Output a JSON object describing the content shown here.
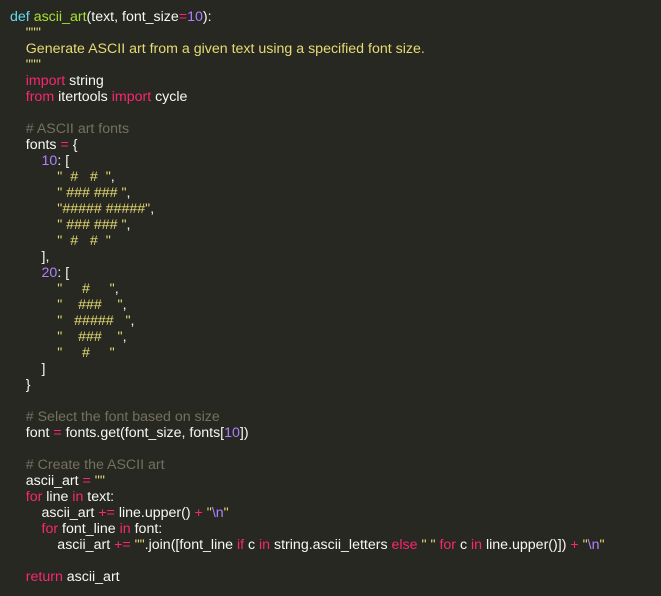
{
  "colors": {
    "background": "#272822",
    "plain": "#f8f8f2",
    "keyword": "#f92672",
    "def_keyword": "#66d9ef",
    "function_name": "#a6e22e",
    "string": "#e6db74",
    "number": "#ae81ff",
    "comment": "#75715e"
  },
  "code": {
    "lines": [
      [
        [
          "kwd",
          "def"
        ],
        [
          "pln",
          " "
        ],
        [
          "fn",
          "ascii_art"
        ],
        [
          "pln",
          "(text, font_size"
        ],
        [
          "op",
          "="
        ],
        [
          "num",
          "10"
        ],
        [
          "pln",
          "):"
        ]
      ],
      [
        [
          "str",
          "    \"\"\""
        ]
      ],
      [
        [
          "str",
          "    Generate ASCII art from a given text using a specified font size."
        ]
      ],
      [
        [
          "str",
          "    \"\"\""
        ]
      ],
      [
        [
          "kw",
          "    import"
        ],
        [
          "pln",
          " string"
        ]
      ],
      [
        [
          "kw",
          "    from"
        ],
        [
          "pln",
          " itertools "
        ],
        [
          "kw",
          "import"
        ],
        [
          "pln",
          " cycle"
        ]
      ],
      [
        [
          "pln",
          ""
        ]
      ],
      [
        [
          "com",
          "    # ASCII art fonts"
        ]
      ],
      [
        [
          "pln",
          "    fonts "
        ],
        [
          "op",
          "="
        ],
        [
          "pln",
          " {"
        ]
      ],
      [
        [
          "num",
          "        10"
        ],
        [
          "pln",
          ": ["
        ]
      ],
      [
        [
          "str",
          "            \"  #   #  \""
        ],
        [
          "pln",
          ","
        ]
      ],
      [
        [
          "str",
          "            \" ### ### \""
        ],
        [
          "pln",
          ","
        ]
      ],
      [
        [
          "str",
          "            \"##### #####\""
        ],
        [
          "pln",
          ","
        ]
      ],
      [
        [
          "str",
          "            \" ### ### \""
        ],
        [
          "pln",
          ","
        ]
      ],
      [
        [
          "str",
          "            \"  #   #  \""
        ]
      ],
      [
        [
          "pln",
          "        ],"
        ]
      ],
      [
        [
          "num",
          "        20"
        ],
        [
          "pln",
          ": ["
        ]
      ],
      [
        [
          "str",
          "            \"     #     \""
        ],
        [
          "pln",
          ","
        ]
      ],
      [
        [
          "str",
          "            \"    ###    \""
        ],
        [
          "pln",
          ","
        ]
      ],
      [
        [
          "str",
          "            \"   #####   \""
        ],
        [
          "pln",
          ","
        ]
      ],
      [
        [
          "str",
          "            \"    ###    \""
        ],
        [
          "pln",
          ","
        ]
      ],
      [
        [
          "str",
          "            \"     #     \""
        ]
      ],
      [
        [
          "pln",
          "        ]"
        ]
      ],
      [
        [
          "pln",
          "    }"
        ]
      ],
      [
        [
          "pln",
          ""
        ]
      ],
      [
        [
          "com",
          "    # Select the font based on size"
        ]
      ],
      [
        [
          "pln",
          "    font "
        ],
        [
          "op",
          "="
        ],
        [
          "pln",
          " fonts.get(font_size, fonts["
        ],
        [
          "num",
          "10"
        ],
        [
          "pln",
          "])"
        ]
      ],
      [
        [
          "pln",
          ""
        ]
      ],
      [
        [
          "com",
          "    # Create the ASCII art"
        ]
      ],
      [
        [
          "pln",
          "    ascii_art "
        ],
        [
          "op",
          "="
        ],
        [
          "str",
          " \"\""
        ]
      ],
      [
        [
          "kw",
          "    for"
        ],
        [
          "pln",
          " line "
        ],
        [
          "kw",
          "in"
        ],
        [
          "pln",
          " text:"
        ]
      ],
      [
        [
          "pln",
          "        ascii_art "
        ],
        [
          "op",
          "+="
        ],
        [
          "pln",
          " line.upper() "
        ],
        [
          "op",
          "+"
        ],
        [
          "str",
          " \""
        ],
        [
          "esc",
          "\\n"
        ],
        [
          "str",
          "\""
        ]
      ],
      [
        [
          "kw",
          "        for"
        ],
        [
          "pln",
          " font_line "
        ],
        [
          "kw",
          "in"
        ],
        [
          "pln",
          " font:"
        ]
      ],
      [
        [
          "pln",
          "            ascii_art "
        ],
        [
          "op",
          "+="
        ],
        [
          "str",
          " \"\""
        ],
        [
          "pln",
          ".join([font_line "
        ],
        [
          "kw",
          "if"
        ],
        [
          "pln",
          " c "
        ],
        [
          "kw",
          "in"
        ],
        [
          "pln",
          " string.ascii_letters "
        ],
        [
          "kw",
          "else"
        ],
        [
          "str",
          " \" \""
        ],
        [
          "kw",
          " for"
        ],
        [
          "pln",
          " c "
        ],
        [
          "kw",
          "in"
        ],
        [
          "pln",
          " line.upper()]) "
        ],
        [
          "op",
          "+"
        ],
        [
          "str",
          " \""
        ],
        [
          "esc",
          "\\n"
        ],
        [
          "str",
          "\""
        ]
      ],
      [
        [
          "pln",
          ""
        ]
      ],
      [
        [
          "kw",
          "    return"
        ],
        [
          "pln",
          " ascii_art"
        ]
      ]
    ]
  }
}
